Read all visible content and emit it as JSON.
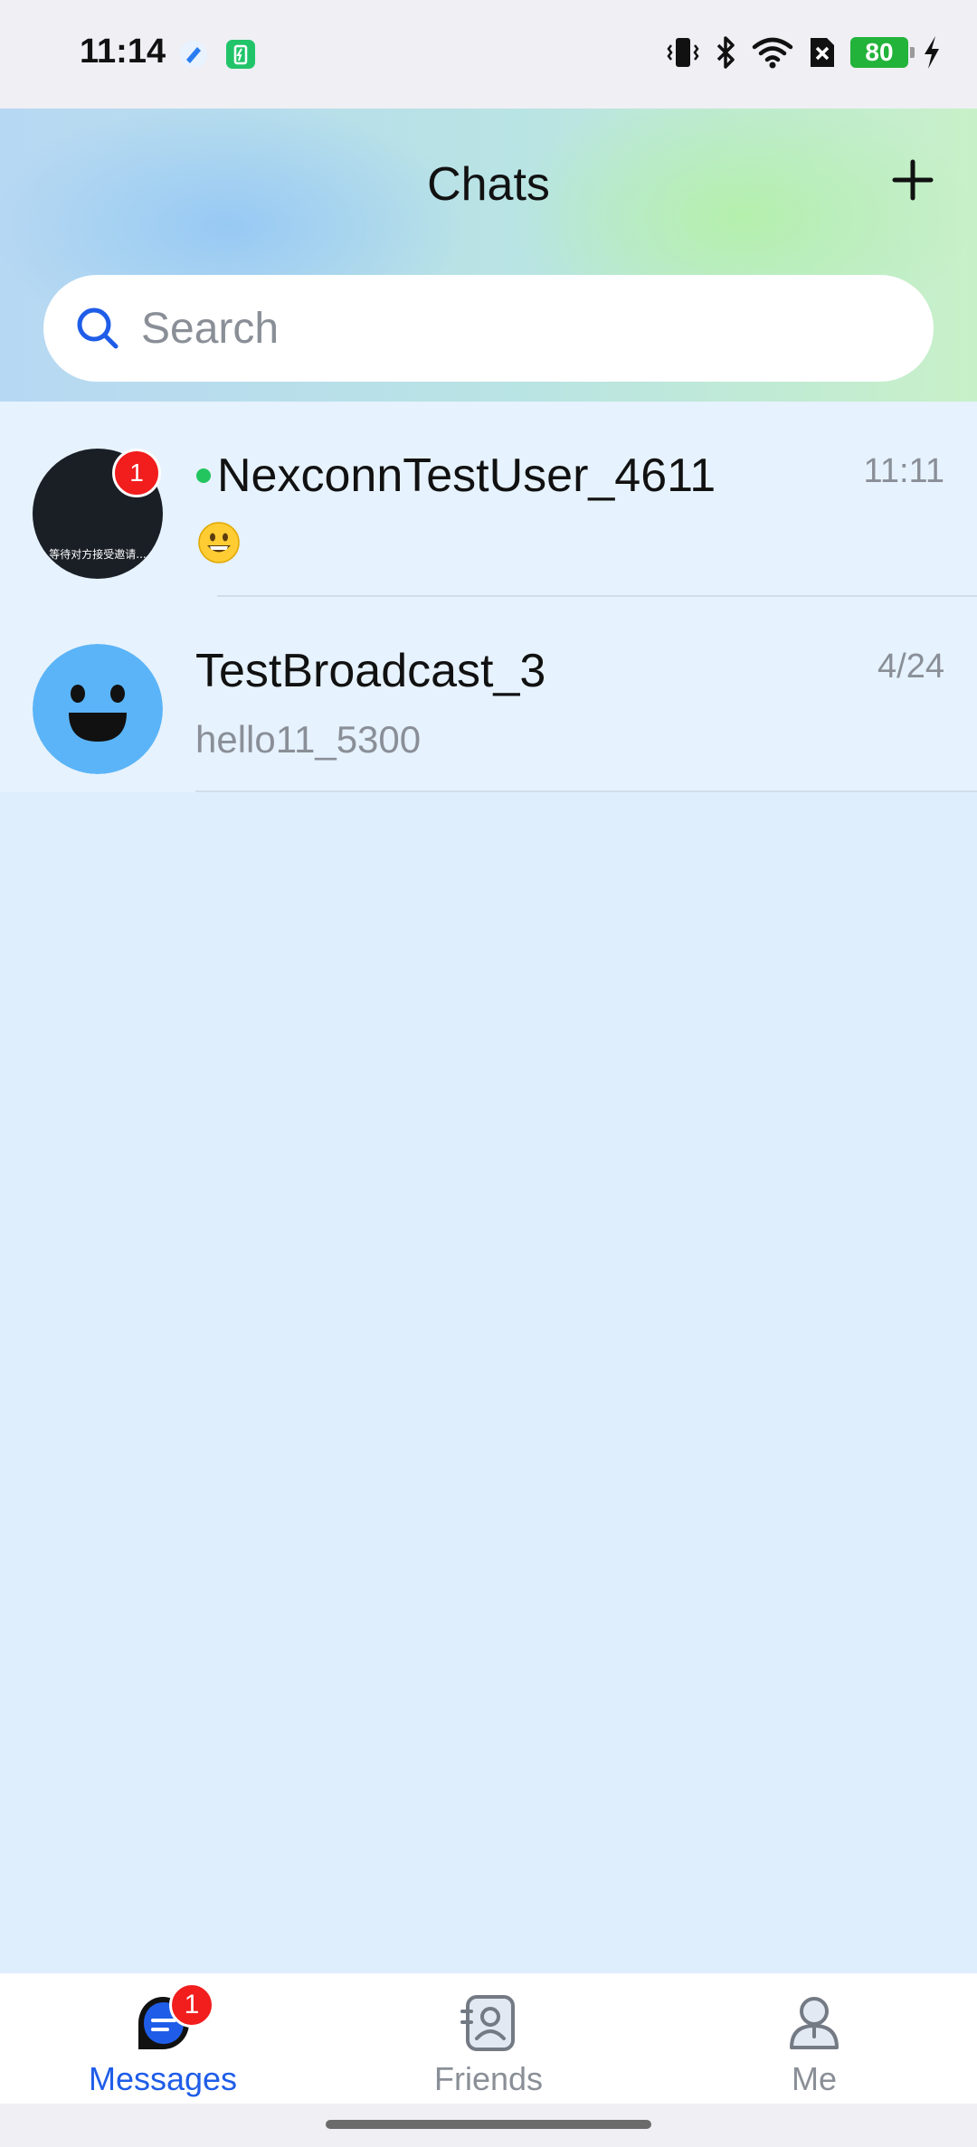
{
  "status_bar": {
    "time": "11:14",
    "battery_level": "80",
    "icons": [
      "app-notification-icon",
      "battery-saver-icon",
      "vibrate-icon",
      "bluetooth-icon",
      "wifi-icon",
      "no-sim-icon",
      "battery-icon",
      "charging-icon"
    ]
  },
  "header": {
    "title": "Chats",
    "add_icon": "plus-icon"
  },
  "search": {
    "placeholder": "Search",
    "value": ""
  },
  "chats": [
    {
      "name": "NexconnTestUser_4611",
      "time": "11:11",
      "preview_emoji": "grinning-face",
      "unread": "1",
      "online": true,
      "avatar_caption": "等待对方接受邀请...",
      "avatar_color": "#1a1f26"
    },
    {
      "name": "TestBroadcast_3",
      "time": "4/24",
      "preview": "hello11_5300",
      "avatar_color": "#5bb4f7"
    }
  ],
  "bottom_nav": {
    "items": [
      {
        "label": "Messages",
        "icon": "messages-icon",
        "badge": "1",
        "active": true
      },
      {
        "label": "Friends",
        "icon": "friends-icon",
        "active": false
      },
      {
        "label": "Me",
        "icon": "me-icon",
        "active": false
      }
    ]
  },
  "colors": {
    "accent": "#1f5de8",
    "badge": "#f21d1d",
    "online": "#22c55e",
    "list_background": "#dfeefc"
  }
}
